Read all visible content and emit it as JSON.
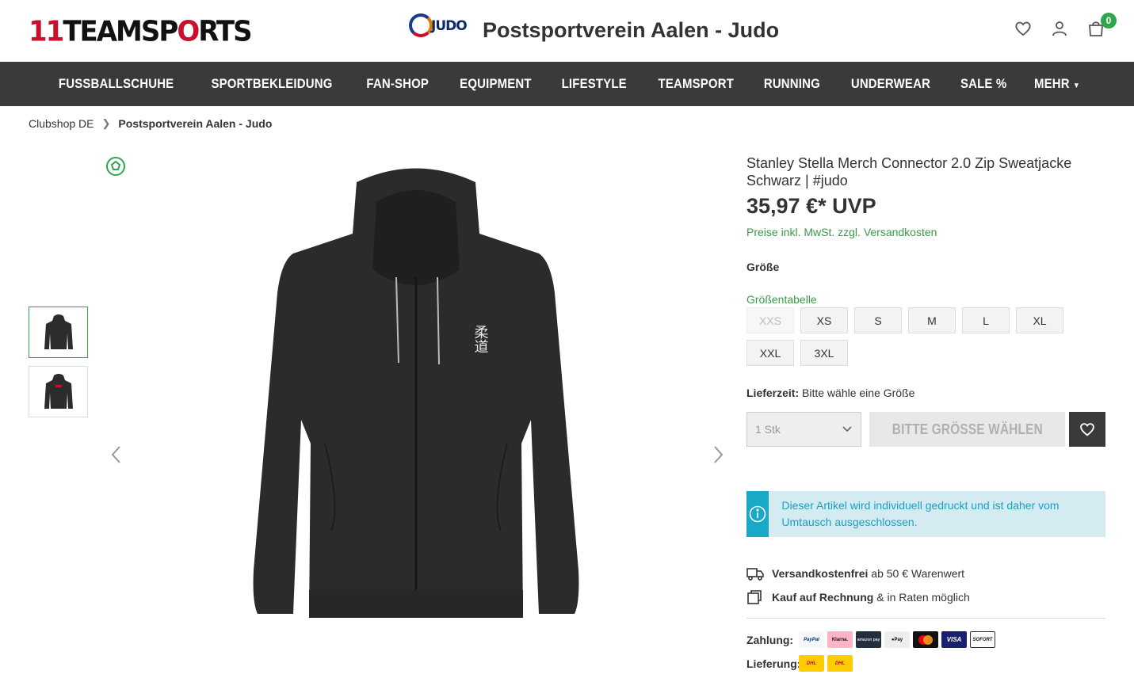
{
  "header": {
    "logo_prefix": "11",
    "logo_main": "TEAMSP",
    "logo_mid": "O",
    "logo_end": "RTS",
    "club_logo_word": "JUDO",
    "club_title": "Postsportverein Aalen - Judo",
    "cart_count": "0"
  },
  "nav": {
    "items": [
      "FUSSBALLSCHUHE",
      "SPORTBEKLEIDUNG",
      "FAN-SHOP",
      "EQUIPMENT",
      "LIFESTYLE",
      "TEAMSPORT",
      "RUNNING",
      "UNDERWEAR",
      "SALE %",
      "MEHR"
    ]
  },
  "breadcrumb": {
    "items": [
      "Clubshop DE",
      "Postsportverein Aalen - Judo"
    ]
  },
  "product": {
    "title": "Stanley Stella Merch Connector 2.0 Zip Sweatjacke Schwarz | #judo",
    "price": "35,97 €* UVP",
    "vat_note": "Preise inkl. MwSt. zzgl. Versandkosten",
    "size_label": "Größe",
    "size_table_link": "Größentabelle",
    "sizes": [
      "XXS",
      "XS",
      "S",
      "M",
      "L",
      "XL",
      "XXL",
      "3XL"
    ],
    "delivery_label": "Lieferzeit:",
    "delivery_value": " Bitte wähle eine Größe",
    "qty_value": "1 Stk",
    "buy_label": "BITTE GRÖSSE WÄHLEN",
    "info_text": "Dieser Artikel wird individuell gedruckt und ist daher vom Umtausch ausgeschlossen.",
    "kanji": "柔道"
  },
  "usps": {
    "shipping_bold": "Versandkostenfrei",
    "shipping_rest": " ab 50 € Warenwert",
    "invoice_bold": "Kauf auf Rechnung",
    "invoice_rest": " & in Raten möglich"
  },
  "payment": {
    "pay_label": "Zahlung:",
    "delivery_label": "Lieferung:",
    "pay_methods": [
      "PayPal",
      "Klarna.",
      "amazon pay",
      "Pay",
      "",
      "VISA",
      "SOFORT"
    ],
    "delivery_methods": [
      "DHL",
      "DHL"
    ]
  },
  "colors": {
    "nav_bg": "#3a3a3a",
    "accent_green": "#2fa64a",
    "info_blue": "#1aa8c7",
    "brand_red": "#c8102e"
  }
}
